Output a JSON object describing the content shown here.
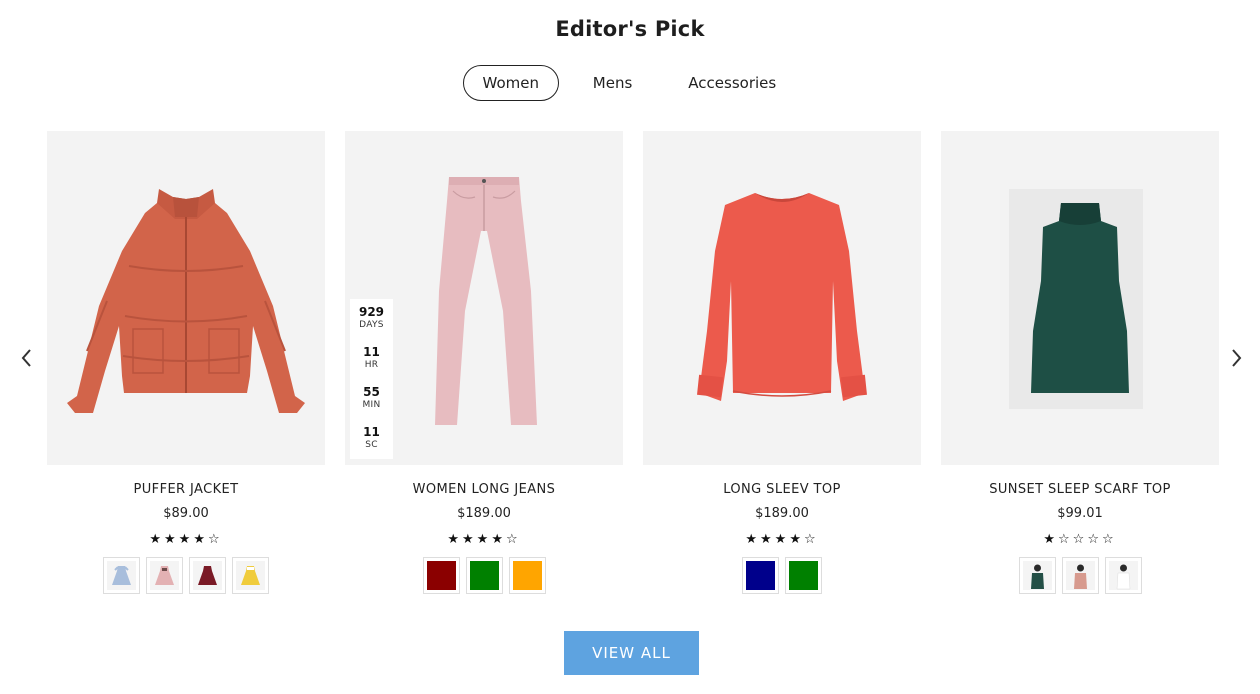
{
  "section": {
    "title": "Editor's Pick"
  },
  "tabs": [
    {
      "label": "Women",
      "active": true
    },
    {
      "label": "Mens",
      "active": false
    },
    {
      "label": "Accessories",
      "active": false
    }
  ],
  "nav": {
    "prev_icon": "chevron-left-icon",
    "next_icon": "chevron-right-icon"
  },
  "products": [
    {
      "name": "PUFFER JACKET",
      "price": "$89.00",
      "rating": 4,
      "stars_text": "★★★★☆",
      "image": "puffer-jacket",
      "swatches": [
        {
          "type": "image",
          "name": "blue-dress-thumb"
        },
        {
          "type": "image",
          "name": "pink-dress-thumb"
        },
        {
          "type": "image",
          "name": "burgundy-dress-thumb"
        },
        {
          "type": "image",
          "name": "yellow-dress-thumb"
        }
      ]
    },
    {
      "name": "WOMEN LONG JEANS",
      "price": "$189.00",
      "rating": 4,
      "stars_text": "★★★★☆",
      "image": "pink-jeans",
      "countdown": {
        "days": "929",
        "days_label": "DAYS",
        "hours": "11",
        "hours_label": "HR",
        "minutes": "55",
        "minutes_label": "MIN",
        "seconds": "11",
        "seconds_label": "SC"
      },
      "swatches": [
        {
          "type": "color",
          "color": "#8b0000"
        },
        {
          "type": "color",
          "color": "#008000"
        },
        {
          "type": "color",
          "color": "#ffa500"
        }
      ]
    },
    {
      "name": "LONG SLEEV TOP",
      "price": "$189.00",
      "rating": 4,
      "stars_text": "★★★★☆",
      "image": "coral-long-sleeve-top",
      "swatches": [
        {
          "type": "color",
          "color": "#00008b"
        },
        {
          "type": "color",
          "color": "#008000"
        }
      ]
    },
    {
      "name": "SUNSET SLEEP SCARF TOP",
      "price": "$99.01",
      "rating": 1,
      "stars_text": "★☆☆☆☆",
      "image": "green-sleeveless-top",
      "swatches": [
        {
          "type": "image",
          "name": "green-top-thumb"
        },
        {
          "type": "image",
          "name": "pink-top-thumb"
        },
        {
          "type": "image",
          "name": "white-top-thumb"
        }
      ]
    }
  ],
  "cta": {
    "view_all_label": "VIEW ALL"
  },
  "colors": {
    "cta_bg": "#5ea3e0",
    "card_bg": "#f3f3f3"
  }
}
